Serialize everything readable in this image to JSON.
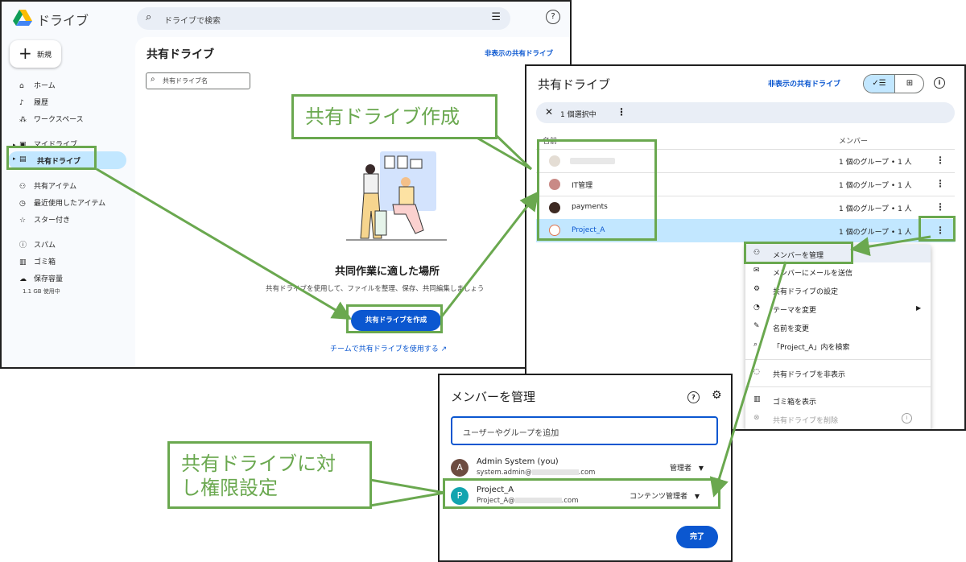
{
  "panel1": {
    "app_title": "ドライブ",
    "search_placeholder": "ドライブで検索",
    "new_label": "新規",
    "nav": [
      {
        "label": "ホーム",
        "icon": "⌂"
      },
      {
        "label": "履歴",
        "icon": "🔔"
      },
      {
        "label": "ワークスペース",
        "icon": "⁂"
      },
      {
        "label": "マイドライブ",
        "icon": "▣"
      },
      {
        "label": "共有ドライブ",
        "icon": "▤"
      },
      {
        "label": "共有アイテム",
        "icon": "👥"
      },
      {
        "label": "最近使用したアイテム",
        "icon": "◷"
      },
      {
        "label": "スター付き",
        "icon": "☆"
      },
      {
        "label": "スパム",
        "icon": "ⓘ"
      },
      {
        "label": "ゴミ箱",
        "icon": "🗑"
      },
      {
        "label": "保存容量",
        "icon": "☁"
      }
    ],
    "storage_text": "1.1 GB 使用中",
    "page_title": "共有ドライブ",
    "hidden_drives_link": "非表示の共有ドライブ",
    "filter_placeholder": "共有ドライブ名",
    "empty_title": "共同作業に適した場所",
    "empty_desc": "共有ドライブを使用して、ファイルを整理、保存、共同編集しましょう",
    "create_button": "共有ドライブを作成",
    "team_link": "チームで共有ドライブを使用する"
  },
  "panel2": {
    "title": "共有ドライブ",
    "hidden_link": "非表示の共有ドライブ",
    "selection_text": "1 個選択中",
    "col_name": "名前",
    "col_members": "メンバー",
    "rows": [
      {
        "name": "",
        "members": "1 個のグループ • 1 人"
      },
      {
        "name": "IT管理",
        "members": "1 個のグループ • 1 人"
      },
      {
        "name": "payments",
        "members": "1 個のグループ • 1 人"
      },
      {
        "name": "Project_A",
        "members": "1 個のグループ • 1 人"
      }
    ],
    "menu": [
      {
        "label": "メンバーを管理",
        "icon": "👥"
      },
      {
        "label": "メンバーにメールを送信",
        "icon": "✉"
      },
      {
        "label": "共有ドライブの設定",
        "icon": "⚙"
      },
      {
        "label": "テーマを変更",
        "icon": "🎨"
      },
      {
        "label": "名前を変更",
        "icon": "✎"
      },
      {
        "label": "「Project_A」内を検索",
        "icon": "🔍"
      },
      {
        "label": "共有ドライブを非表示",
        "icon": "◌"
      },
      {
        "label": "ゴミ箱を表示",
        "icon": "🗑"
      },
      {
        "label": "共有ドライブを削除",
        "icon": "⊗"
      }
    ]
  },
  "panel3": {
    "title": "メンバーを管理",
    "add_placeholder": "ユーザーやグループを追加",
    "members": [
      {
        "avatar": "A",
        "name": "Admin System (you)",
        "email": "system.admin@",
        "email_tail": ".com",
        "role": "管理者",
        "avatar_color": "#6d4c41"
      },
      {
        "avatar": "P",
        "name": "Project_A",
        "email": "Project_A@",
        "email_tail": ".com",
        "role": "コンテンツ管理者",
        "avatar_color": "#12a4af"
      }
    ],
    "done_button": "完了"
  },
  "callouts": {
    "create": "共有ドライブ作成",
    "permission_line1": "共有ドライブに対",
    "permission_line2": "し権限設定"
  },
  "colors": {
    "accent_green": "#6aa84f",
    "primary_blue": "#0b57d0",
    "selected_bg": "#c2e7ff"
  }
}
